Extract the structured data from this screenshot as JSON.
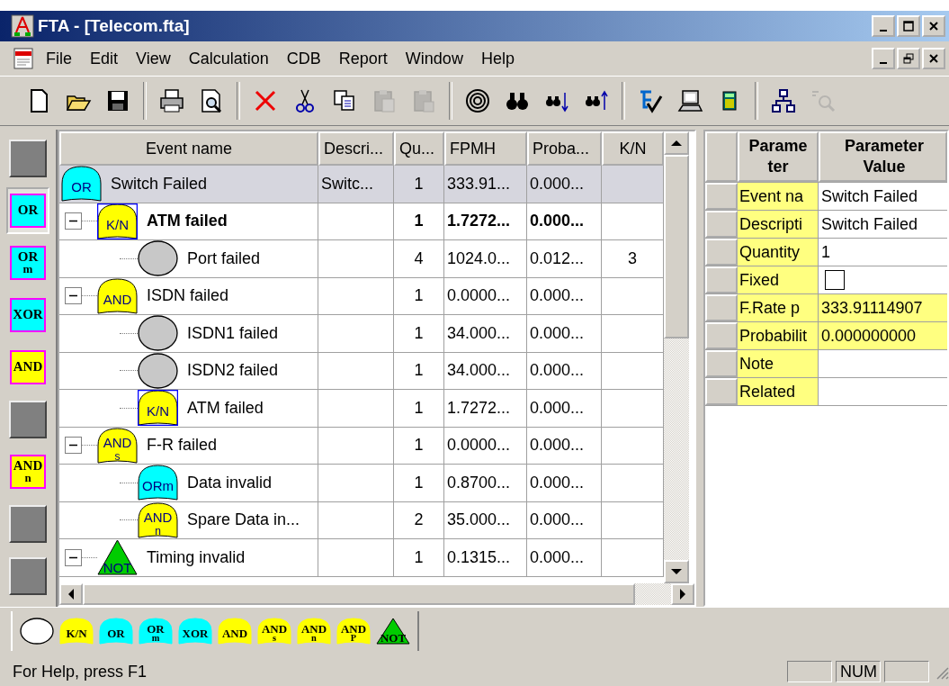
{
  "window": {
    "title": "FTA - [Telecom.fta]"
  },
  "menu": [
    "File",
    "Edit",
    "View",
    "Calculation",
    "CDB",
    "Report",
    "Window",
    "Help"
  ],
  "toolbar": [
    {
      "kind": "new",
      "disabled": false
    },
    {
      "kind": "open",
      "disabled": false
    },
    {
      "kind": "save",
      "disabled": false
    },
    {
      "kind": "separator"
    },
    {
      "kind": "print",
      "disabled": false
    },
    {
      "kind": "preview",
      "disabled": false
    },
    {
      "kind": "separator"
    },
    {
      "kind": "delete",
      "disabled": false
    },
    {
      "kind": "cut",
      "disabled": false
    },
    {
      "kind": "copy",
      "disabled": false
    },
    {
      "kind": "paste",
      "disabled": true
    },
    {
      "kind": "paste-special",
      "disabled": true
    },
    {
      "kind": "separator"
    },
    {
      "kind": "target",
      "disabled": false
    },
    {
      "kind": "find",
      "disabled": false
    },
    {
      "kind": "find-next",
      "disabled": false
    },
    {
      "kind": "find-previous",
      "disabled": false
    },
    {
      "kind": "separator"
    },
    {
      "kind": "tree-check",
      "disabled": false
    },
    {
      "kind": "computer",
      "disabled": false
    },
    {
      "kind": "calculator",
      "disabled": false
    },
    {
      "kind": "separator"
    },
    {
      "kind": "hierarchy",
      "disabled": false
    },
    {
      "kind": "zoom",
      "disabled": true
    }
  ],
  "left_palette": [
    {
      "kind": "blank",
      "selected": false
    },
    {
      "kind": "gate",
      "selected": true,
      "label": "OR",
      "color": "#00ffff"
    },
    {
      "kind": "gate",
      "selected": false,
      "label": "OR",
      "sub": "m",
      "color": "#00ffff"
    },
    {
      "kind": "gate",
      "selected": false,
      "label": "XOR",
      "color": "#00ffff"
    },
    {
      "kind": "gate",
      "selected": false,
      "label": "AND",
      "color": "#ffff00"
    },
    {
      "kind": "blank",
      "selected": false
    },
    {
      "kind": "gate",
      "selected": false,
      "label": "AND",
      "sub": "n",
      "color": "#ffff00"
    },
    {
      "kind": "blank",
      "selected": false
    },
    {
      "kind": "blank",
      "selected": false
    }
  ],
  "tree": {
    "columns": [
      "Event name",
      "Descri...",
      "Qu...",
      "FPMH",
      "Proba...",
      "K/N"
    ],
    "rows": [
      {
        "name": "Switch Failed",
        "description": "Switc...",
        "quantity": "1",
        "fpmh": "333.91...",
        "probability": "0.000...",
        "selected": true,
        "bold": false,
        "gate": {
          "kind": "dome",
          "label": "OR",
          "color": "#00ffff",
          "framed": false
        },
        "children": [
          {
            "name": "ATM failed",
            "quantity": "1",
            "fpmh": "1.7272...",
            "probability": "0.000...",
            "selected": false,
            "bold": true,
            "expanded": true,
            "gate": {
              "kind": "dome",
              "label": "K/N",
              "color": "#ffff00",
              "framed": true
            },
            "children": [
              {
                "name": "Port failed",
                "quantity": "4",
                "fpmh": "1024.0...",
                "probability": "0.012...",
                "kn": "3",
                "selected": false,
                "bold": false,
                "gate": {
                  "kind": "circle",
                  "color": "#c8c8c8",
                  "framed": false
                }
              }
            ]
          },
          {
            "name": "ISDN failed",
            "quantity": "1",
            "fpmh": "0.0000...",
            "probability": "0.000...",
            "selected": false,
            "bold": false,
            "expanded": true,
            "gate": {
              "kind": "dome",
              "label": "AND",
              "color": "#ffff00",
              "framed": false
            },
            "children": [
              {
                "name": "ISDN1 failed",
                "quantity": "1",
                "fpmh": "34.000...",
                "probability": "0.000...",
                "selected": false,
                "bold": false,
                "gate": {
                  "kind": "circle",
                  "color": "#c8c8c8",
                  "framed": false
                }
              },
              {
                "name": "ISDN2 failed",
                "quantity": "1",
                "fpmh": "34.000...",
                "probability": "0.000...",
                "selected": false,
                "bold": false,
                "gate": {
                  "kind": "circle",
                  "color": "#c8c8c8",
                  "framed": false
                }
              },
              {
                "name": "ATM failed",
                "quantity": "1",
                "fpmh": "1.7272...",
                "probability": "0.000...",
                "selected": false,
                "bold": false,
                "gate": {
                  "kind": "dome",
                  "label": "K/N",
                  "color": "#ffff00",
                  "framed": true
                }
              }
            ]
          },
          {
            "name": "F-R failed",
            "quantity": "1",
            "fpmh": "0.0000...",
            "probability": "0.000...",
            "selected": false,
            "bold": false,
            "expanded": true,
            "gate": {
              "kind": "dome",
              "label": "AND",
              "sub": "s",
              "color": "#ffff00",
              "framed": false
            },
            "children": [
              {
                "name": "Data invalid",
                "quantity": "1",
                "fpmh": "0.8700...",
                "probability": "0.000...",
                "selected": false,
                "bold": false,
                "gate": {
                  "kind": "dome",
                  "label": "ORm",
                  "color": "#00ffff",
                  "framed": false
                }
              },
              {
                "name": "Spare Data in...",
                "quantity": "2",
                "fpmh": "35.000...",
                "probability": "0.000...",
                "selected": false,
                "bold": false,
                "gate": {
                  "kind": "dome",
                  "label": "AND",
                  "sub": "n",
                  "color": "#ffff00",
                  "framed": false
                }
              }
            ]
          },
          {
            "name": "Timing invalid",
            "quantity": "1",
            "fpmh": "0.1315...",
            "probability": "0.000...",
            "selected": false,
            "bold": false,
            "expanded": true,
            "gate": {
              "kind": "triangle",
              "label": "NOT",
              "color": "#00cc00",
              "framed": false
            }
          }
        ]
      }
    ]
  },
  "parameters": {
    "columns": [
      "Parameter",
      "Parameter Value"
    ],
    "rows": [
      {
        "name": "Event na",
        "kind": "text",
        "value": "Switch Failed",
        "highlighted": false
      },
      {
        "name": "Descripti",
        "kind": "text",
        "value": "Switch Failed",
        "highlighted": false
      },
      {
        "name": "Quantity",
        "kind": "text",
        "value": "1",
        "highlighted": false
      },
      {
        "name": "Fixed",
        "kind": "checkbox",
        "checked": false,
        "highlighted": false
      },
      {
        "name": "F.Rate p",
        "kind": "text",
        "value": "333.91114907",
        "highlighted": true
      },
      {
        "name": "Probabilit",
        "kind": "text",
        "value": "0.000000000",
        "highlighted": true
      },
      {
        "name": "Note",
        "kind": "text",
        "highlighted": false
      },
      {
        "name": "Related",
        "kind": "text",
        "highlighted": false
      }
    ]
  },
  "gate_palette": [
    {
      "kind": "circle",
      "color": "#ffffff"
    },
    {
      "kind": "dome",
      "label": "K/N",
      "color": "#ffff00"
    },
    {
      "kind": "dome",
      "label": "OR",
      "color": "#00ffff"
    },
    {
      "kind": "dome",
      "label": "OR",
      "sub": "m",
      "color": "#00ffff"
    },
    {
      "kind": "dome",
      "label": "XOR",
      "color": "#00ffff"
    },
    {
      "kind": "dome",
      "label": "AND",
      "color": "#ffff00"
    },
    {
      "kind": "dome",
      "label": "AND",
      "sub": "s",
      "color": "#ffff00"
    },
    {
      "kind": "dome",
      "label": "AND",
      "sub": "n",
      "color": "#ffff00"
    },
    {
      "kind": "dome",
      "label": "AND",
      "sub": "P",
      "color": "#ffff00"
    },
    {
      "kind": "triangle",
      "label": "NOT",
      "color": "#00cc00"
    }
  ],
  "status_bar": {
    "text": "For Help, press F1",
    "indicators": [
      "NUM"
    ]
  }
}
